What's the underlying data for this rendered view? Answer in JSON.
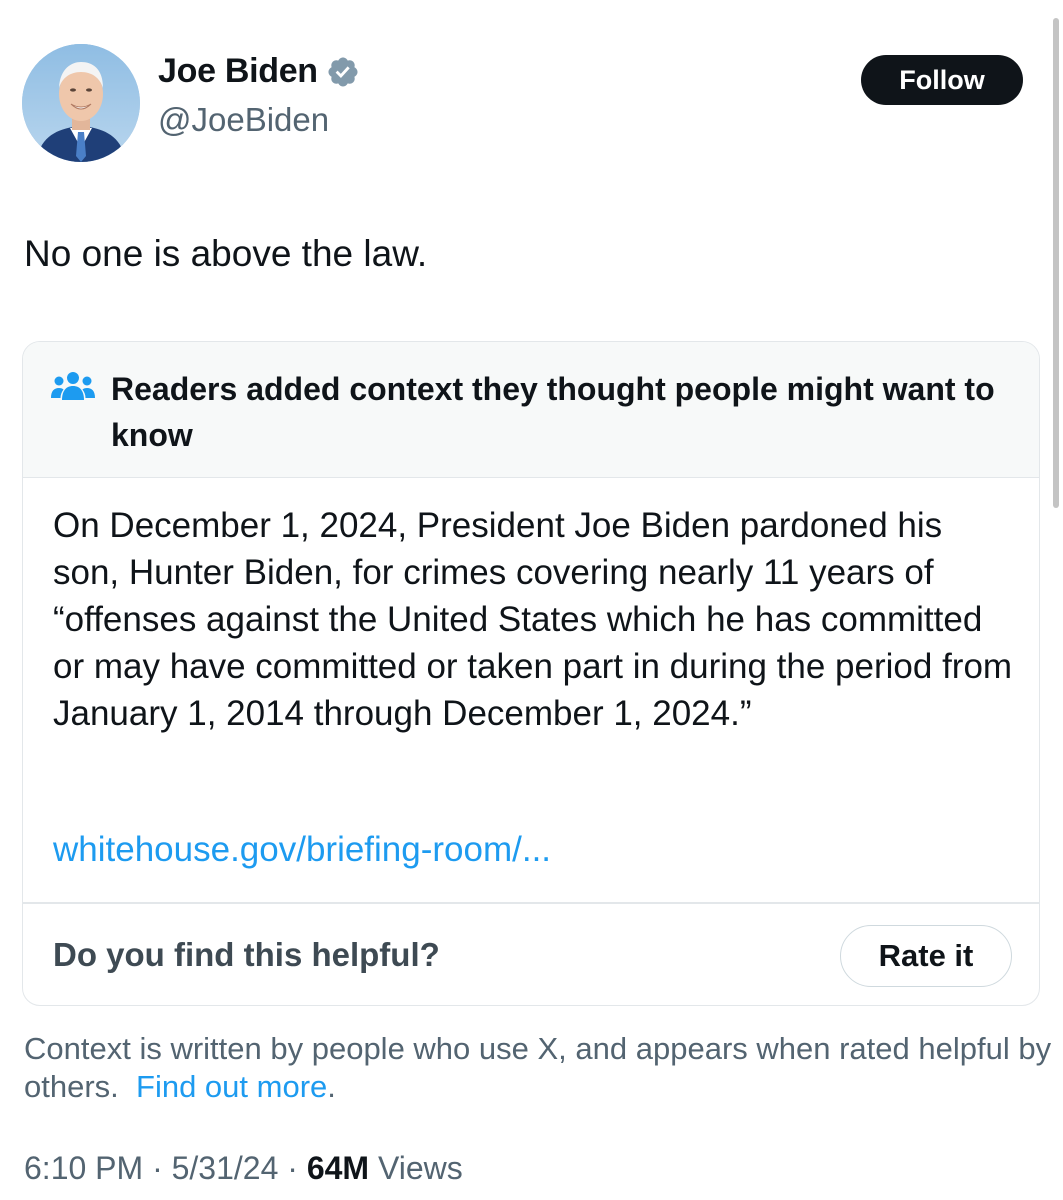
{
  "author": {
    "display_name": "Joe Biden",
    "handle": "@JoeBiden",
    "verified_badge_icon": "verified-badge-icon",
    "verified_color": "#829aab"
  },
  "follow_button": {
    "label": "Follow"
  },
  "tweet": {
    "text": "No one is above the law."
  },
  "community_note": {
    "header_icon": "people-icon",
    "header_icon_color": "#1d9bf0",
    "title": "Readers added context they thought people might want to know",
    "body": "On December 1, 2024, President Joe Biden pardoned his son, Hunter Biden, for crimes covering nearly 11 years of “offenses against the United States which he has committed or may have committed or taken part in during the period from January 1, 2014 through December 1, 2024.”",
    "link_text": "whitehouse.gov/briefing-room/...",
    "helpful_question": "Do you find this helpful?",
    "rate_button_label": "Rate it"
  },
  "context_footnote": {
    "text": "Context is written by people who use X, and appears when rated helpful by others.",
    "link_text": "Find out more",
    "trailing": "."
  },
  "meta": {
    "time": "6:10 PM",
    "separator": " · ",
    "date": "5/31/24",
    "views_count": "64M",
    "views_label": " Views"
  },
  "colors": {
    "link_blue": "#1d9bf0",
    "secondary_text": "#536471",
    "primary_text": "#0f1419",
    "note_header_bg": "#f7f9f9",
    "border": "#e3e7ea"
  }
}
